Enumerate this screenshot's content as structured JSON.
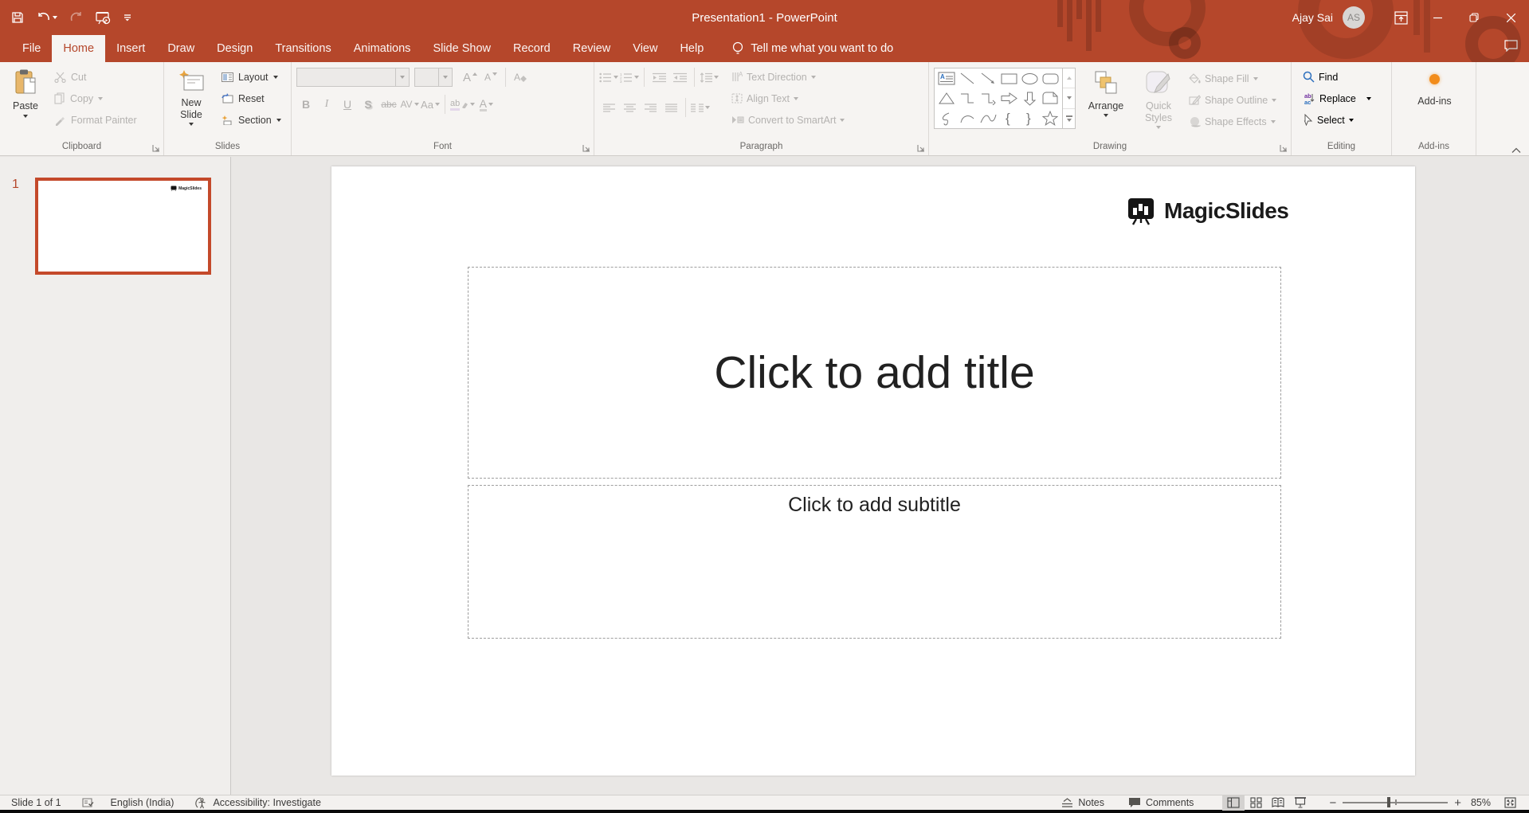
{
  "window": {
    "title": "Presentation1  -  PowerPoint",
    "user_name": "Ajay Sai",
    "user_initials": "AS"
  },
  "quick_access_toolbar": {
    "icons": [
      "save-icon",
      "undo-icon",
      "redo-icon",
      "start-slideshow-icon",
      "customize-qat-icon"
    ]
  },
  "tabs": [
    "File",
    "Home",
    "Insert",
    "Draw",
    "Design",
    "Transitions",
    "Animations",
    "Slide Show",
    "Record",
    "Review",
    "View",
    "Help"
  ],
  "active_tab": "Home",
  "search": {
    "tell_me": "Tell me what you want to do"
  },
  "ribbon": {
    "clipboard": {
      "label": "Clipboard",
      "paste": "Paste",
      "cut": "Cut",
      "copy": "Copy",
      "format_painter": "Format Painter"
    },
    "slides": {
      "label": "Slides",
      "new_slide": "New Slide",
      "layout": "Layout",
      "reset": "Reset",
      "section": "Section"
    },
    "font": {
      "label": "Font",
      "font_name_value": "",
      "font_size_value": "",
      "glyphs": {
        "bold": "B",
        "italic": "I",
        "underline": "U",
        "shadow": "S",
        "strike": "abc",
        "spacing": "AV",
        "case": "Aa",
        "grow": "A",
        "shrink": "A",
        "highlight": "ab",
        "color": "A"
      }
    },
    "paragraph": {
      "label": "Paragraph",
      "text_direction": "Text Direction",
      "align_text": "Align Text",
      "convert_smartart": "Convert to SmartArt"
    },
    "drawing": {
      "label": "Drawing",
      "arrange": "Arrange",
      "quick_styles": "Quick Styles",
      "shape_fill": "Shape Fill",
      "shape_outline": "Shape Outline",
      "shape_effects": "Shape Effects",
      "shapes_gallery": [
        "text-box",
        "line",
        "line-arrow",
        "rectangle",
        "oval",
        "rounded-rectangle",
        "triangle",
        "elbow-connector",
        "elbow-arrow-connector",
        "right-arrow",
        "down-arrow",
        "snip-corner-shape",
        "scribble",
        "arc",
        "curve",
        "left-brace",
        "right-brace",
        "star"
      ]
    },
    "editing": {
      "label": "Editing",
      "find": "Find",
      "replace": "Replace",
      "select": "Select"
    },
    "addins": {
      "label": "Add-ins",
      "button": "Add-ins"
    }
  },
  "slides_panel": {
    "slides": [
      {
        "number": "1"
      }
    ]
  },
  "canvas": {
    "brand": "MagicSlides",
    "title_placeholder": "Click to add title",
    "subtitle_placeholder": "Click to add subtitle"
  },
  "statusbar": {
    "slide_indicator": "Slide 1 of 1",
    "language": "English (India)",
    "accessibility": "Accessibility: Investigate",
    "notes_label": "Notes",
    "comments_label": "Comments",
    "zoom_level": "85%"
  },
  "colors": {
    "titlebar_red": "#B5472B",
    "active_tab_text": "#B5472B",
    "ribbon_bg": "#f6f4f2",
    "disabled_text": "#b4b2b0",
    "enabled_text": "#3b3a39",
    "thumbnail_selection": "#C4492A",
    "paste_clipboard_amber": "#E8B76B",
    "arrange_amber": "#EFC36F",
    "addins_dot_orange": "#F28C1B",
    "find_blue": "#2C6FBD",
    "newslide_star_orange": "#E8A33D"
  }
}
